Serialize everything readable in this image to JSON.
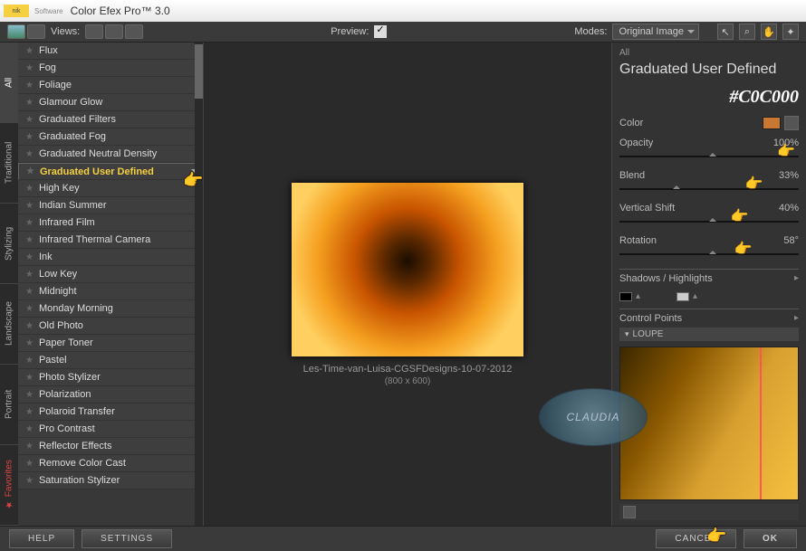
{
  "title": "Color Efex Pro™ 3.0",
  "logo_sub": "Software",
  "topbar": {
    "views_label": "Views:",
    "preview_label": "Preview:",
    "modes_label": "Modes:",
    "mode_selected": "Original Image"
  },
  "vtabs": [
    {
      "label": "All",
      "active": true
    },
    {
      "label": "Traditional"
    },
    {
      "label": "Stylizing"
    },
    {
      "label": "Landscape"
    },
    {
      "label": "Portrait"
    },
    {
      "label": "Favorites",
      "fav": true
    }
  ],
  "filters": [
    "Flux",
    "Fog",
    "Foliage",
    "Glamour Glow",
    "Graduated Filters",
    "Graduated Fog",
    "Graduated Neutral Density",
    "Graduated User Defined",
    "High Key",
    "Indian Summer",
    "Infrared Film",
    "Infrared Thermal Camera",
    "Ink",
    "Low Key",
    "Midnight",
    "Monday Morning",
    "Old Photo",
    "Paper Toner",
    "Pastel",
    "Photo Stylizer",
    "Polarization",
    "Polaroid Transfer",
    "Pro Contrast",
    "Reflector Effects",
    "Remove Color Cast",
    "Saturation Stylizer"
  ],
  "filter_selected": "Graduated User Defined",
  "canvas": {
    "filename": "Les-Time-van-Luisa-CGSFDesigns-10-07-2012",
    "dims": "(800 x 600)"
  },
  "panel": {
    "breadcrumb": "All",
    "title": "Graduated User Defined",
    "hex": "#C0C000",
    "color_label": "Color",
    "swatch_color": "#c87830",
    "params": [
      {
        "label": "Opacity",
        "value": "100%",
        "handpos": "88%",
        "tick": "50%"
      },
      {
        "label": "Blend",
        "value": "33%",
        "handpos": "70%",
        "tick": "30%"
      },
      {
        "label": "Vertical Shift",
        "value": "40%",
        "handpos": "62%",
        "tick": "50%"
      },
      {
        "label": "Rotation",
        "value": "58°",
        "handpos": "64%",
        "tick": "50%"
      }
    ],
    "shadows_label": "Shadows / Highlights",
    "cp_label": "Control Points",
    "loupe_label": "LOUPE"
  },
  "buttons": {
    "help": "HELP",
    "settings": "SETTINGS",
    "cancel": "CANCEL",
    "ok": "OK"
  },
  "watermark": "CLAUDIA"
}
